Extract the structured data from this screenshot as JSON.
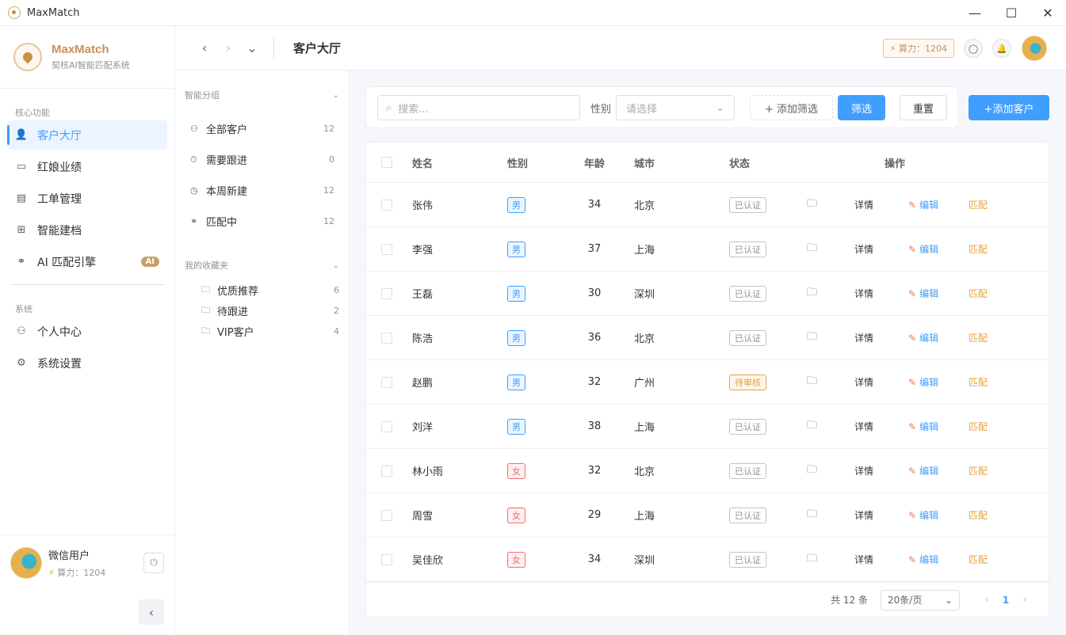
{
  "window": {
    "title": "MaxMatch",
    "controls": {
      "minimize": "—",
      "maximize": "☐",
      "close": "✕"
    }
  },
  "sidebar": {
    "brand_name": "MaxMatch",
    "brand_sub": "契核AI智能匹配系统",
    "section_core": "核心功能",
    "items": [
      {
        "label": "客户大厅",
        "icon": "user-icon",
        "glyph": "👤"
      },
      {
        "label": "红娘业绩",
        "icon": "presentation-icon",
        "glyph": "▭"
      },
      {
        "label": "工单管理",
        "icon": "document-icon",
        "glyph": "▤"
      },
      {
        "label": "智能建档",
        "icon": "add-document-icon",
        "glyph": "⊞"
      },
      {
        "label": "AI 匹配引擎",
        "icon": "link-icon",
        "glyph": "⚭",
        "badge": "AI"
      }
    ],
    "section_system": "系统",
    "system_items": [
      {
        "label": "个人中心",
        "icon": "person-icon",
        "glyph": "⚇"
      },
      {
        "label": "系统设置",
        "icon": "gear-icon",
        "glyph": "⚙"
      }
    ],
    "user": {
      "name": "微信用户",
      "power_label": "算力：1204"
    }
  },
  "header": {
    "title": "客户大厅",
    "power_chip": "算力：1204"
  },
  "groups": {
    "smart_title": "智能分组",
    "smart_items": [
      {
        "label": "全部客户",
        "count": "12",
        "glyph": "⚇"
      },
      {
        "label": "需要跟进",
        "count": "0",
        "glyph": "⏱"
      },
      {
        "label": "本周新建",
        "count": "12",
        "glyph": "◷"
      },
      {
        "label": "匹配中",
        "count": "12",
        "glyph": "⚭"
      }
    ],
    "fav_title": "我的收藏夹",
    "fav_items": [
      {
        "label": "优质推荐",
        "count": "6"
      },
      {
        "label": "待跟进",
        "count": "2"
      },
      {
        "label": "VIP客户",
        "count": "4"
      }
    ]
  },
  "filters": {
    "search_placeholder": "搜索...",
    "sex_label": "性别",
    "sex_select_placeholder": "请选择",
    "add_filter": "+ 添加筛选",
    "filter_btn": "筛选",
    "reset_btn": "重置",
    "add_customer": "+添加客户"
  },
  "table": {
    "columns": {
      "name": "姓名",
      "sex": "性别",
      "age": "年龄",
      "city": "城市",
      "status": "状态",
      "ops": "操作"
    },
    "ops_labels": {
      "detail": "详情",
      "edit": "编辑",
      "match": "匹配"
    },
    "rows": [
      {
        "name": "张伟",
        "sex": "男",
        "age": "34",
        "city": "北京",
        "status": "已认证"
      },
      {
        "name": "李强",
        "sex": "男",
        "age": "37",
        "city": "上海",
        "status": "已认证"
      },
      {
        "name": "王磊",
        "sex": "男",
        "age": "30",
        "city": "深圳",
        "status": "已认证"
      },
      {
        "name": "陈浩",
        "sex": "男",
        "age": "36",
        "city": "北京",
        "status": "已认证"
      },
      {
        "name": "赵鹏",
        "sex": "男",
        "age": "32",
        "city": "广州",
        "status": "待审核"
      },
      {
        "name": "刘洋",
        "sex": "男",
        "age": "38",
        "city": "上海",
        "status": "已认证"
      },
      {
        "name": "林小雨",
        "sex": "女",
        "age": "32",
        "city": "北京",
        "status": "已认证"
      },
      {
        "name": "周雪",
        "sex": "女",
        "age": "29",
        "city": "上海",
        "status": "已认证"
      },
      {
        "name": "吴佳欣",
        "sex": "女",
        "age": "34",
        "city": "深圳",
        "status": "已认证"
      }
    ]
  },
  "pagination": {
    "total": "共 12 条",
    "page_size": "20条/页",
    "current_page": "1"
  },
  "colors": {
    "primary": "#409eff",
    "brand": "#c7925a",
    "warning": "#e6a23c",
    "danger": "#f56c6c"
  }
}
